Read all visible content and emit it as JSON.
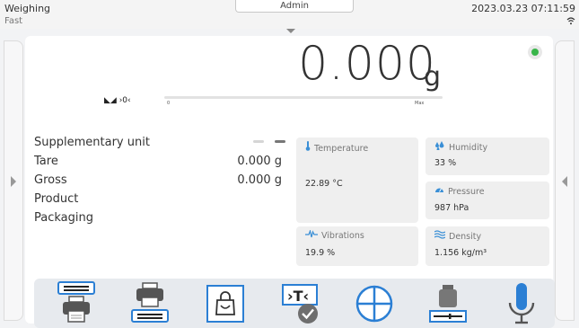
{
  "header": {
    "mode": "Weighing",
    "speed": "Fast",
    "user": "Admin",
    "datetime": "2023.03.23 07:11:59",
    "wifi_icon": "wifi-icon"
  },
  "display": {
    "value": "0.000",
    "unit": "g",
    "status_text": "◣◢ ›0‹",
    "range_min": "0",
    "range_max": "Max",
    "stable_color": "#39b54a"
  },
  "info": [
    {
      "label": "Supplementary unit",
      "value": ""
    },
    {
      "label": "Tare",
      "value": "0.000 g"
    },
    {
      "label": "Gross",
      "value": "0.000 g"
    },
    {
      "label": "Product",
      "value": ""
    },
    {
      "label": "Packaging",
      "value": ""
    }
  ],
  "tiles": {
    "temperature": {
      "title": "Temperature",
      "value": "22.89 °C"
    },
    "humidity": {
      "title": "Humidity",
      "value": "33 %"
    },
    "pressure": {
      "title": "Pressure",
      "value": "987 hPa"
    },
    "vibrations": {
      "title": "Vibrations",
      "value": "19.9 %"
    },
    "density": {
      "title": "Density",
      "value": "1.156 kg/m³"
    }
  },
  "toolbar": {
    "icons": [
      "print-header-icon",
      "print-footer-icon",
      "packaging-icon",
      "tare-icon",
      "zero-icon",
      "calibration-icon",
      "microphone-icon"
    ]
  },
  "colors": {
    "accent_blue": "#2b7fd4",
    "stable_green": "#39b54a"
  }
}
